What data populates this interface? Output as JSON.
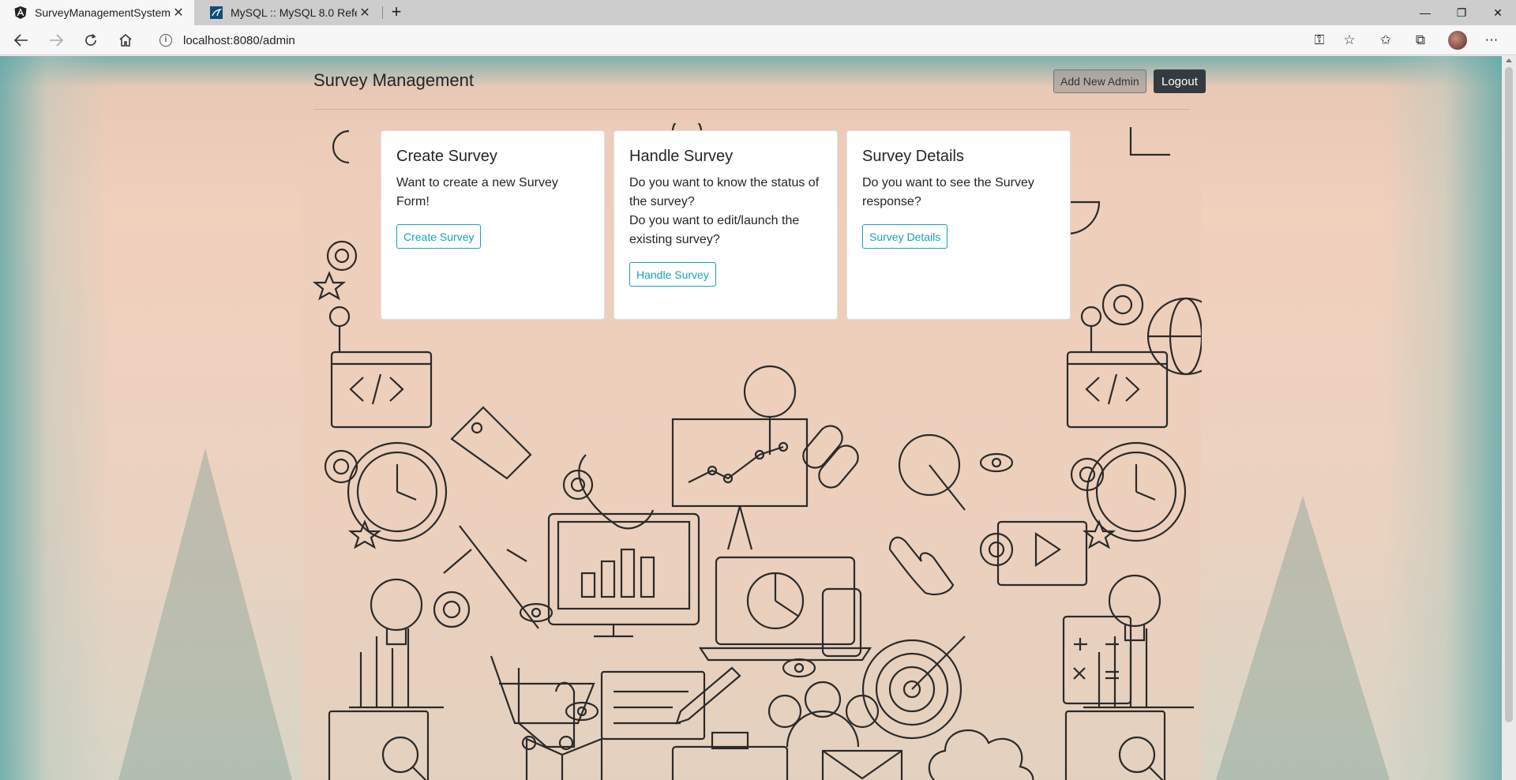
{
  "browser": {
    "tabs": [
      {
        "title": "SurveyManagementSystem",
        "active": true
      },
      {
        "title": "MySQL :: MySQL 8.0 Reference M",
        "active": false
      }
    ],
    "url": "localhost:8080/admin",
    "info_glyph": "i"
  },
  "app": {
    "brand": "Survey Management",
    "header_buttons": {
      "add_admin": "Add New Admin",
      "logout": "Logout"
    }
  },
  "cards": [
    {
      "title": "Create Survey",
      "lines": [
        "Want to create a new Survey Form!"
      ],
      "button": "Create Survey"
    },
    {
      "title": "Handle Survey",
      "lines": [
        "Do you want to know the status of the survey?",
        "Do you want to edit/launch the existing survey?"
      ],
      "button": "Handle Survey"
    },
    {
      "title": "Survey Details",
      "lines": [
        "Do you want to see the Survey response?"
      ],
      "button": "Survey Details"
    }
  ],
  "colors": {
    "accent_outline": "#17a2b8",
    "logout_bg": "#343a40"
  }
}
